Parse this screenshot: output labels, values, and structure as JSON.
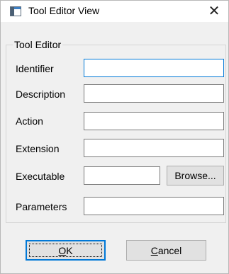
{
  "window": {
    "title": "Tool Editor View",
    "icon": "app-window-icon",
    "close_symbol": "✕"
  },
  "group": {
    "label": "Tool Editor"
  },
  "fields": {
    "identifier": {
      "label": "Identifier",
      "value": ""
    },
    "description": {
      "label": "Description",
      "value": ""
    },
    "action": {
      "label": "Action",
      "value": ""
    },
    "extension": {
      "label": "Extension",
      "value": ""
    },
    "executable": {
      "label": "Executable",
      "value": ""
    },
    "parameters": {
      "label": "Parameters",
      "value": ""
    }
  },
  "buttons": {
    "browse": "Browse...",
    "ok_mnemonic": "O",
    "ok_rest": "K",
    "cancel_mnemonic": "C",
    "cancel_rest": "ancel"
  },
  "colors": {
    "focus_accent": "#0078d7",
    "dialog_background": "#f0f0f0"
  }
}
